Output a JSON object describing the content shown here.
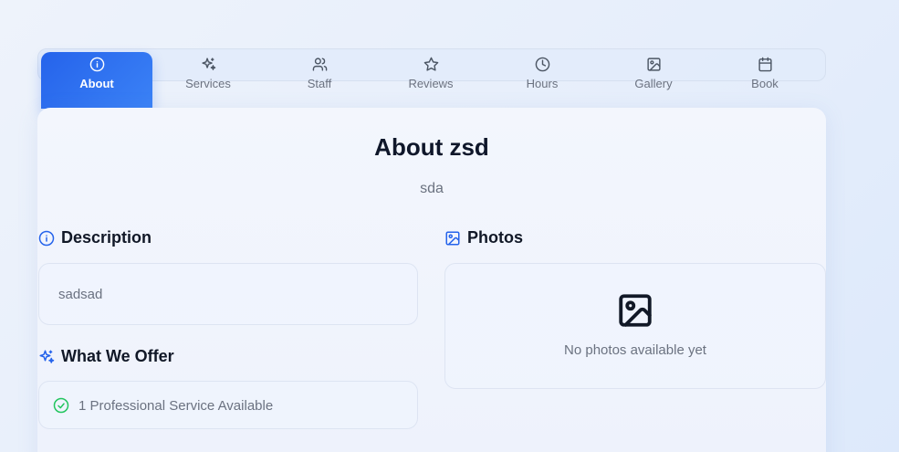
{
  "tabs": [
    {
      "label": "About",
      "icon": "info-icon",
      "active": true
    },
    {
      "label": "Services",
      "icon": "sparkles-icon",
      "active": false
    },
    {
      "label": "Staff",
      "icon": "users-icon",
      "active": false
    },
    {
      "label": "Reviews",
      "icon": "star-icon",
      "active": false
    },
    {
      "label": "Hours",
      "icon": "clock-icon",
      "active": false
    },
    {
      "label": "Gallery",
      "icon": "image-icon",
      "active": false
    },
    {
      "label": "Book",
      "icon": "calendar-icon",
      "active": false
    }
  ],
  "header": {
    "title": "About zsd",
    "subtitle": "sda"
  },
  "description": {
    "heading": "Description",
    "text": "sadsad"
  },
  "photos": {
    "heading": "Photos",
    "empty_text": "No photos available yet"
  },
  "offer": {
    "heading": "What We Offer",
    "item": "1 Professional Service Available"
  },
  "colors": {
    "accent": "#2563eb",
    "success": "#22c55e",
    "text_muted": "#6b7280",
    "text_dark": "#0f172a"
  }
}
